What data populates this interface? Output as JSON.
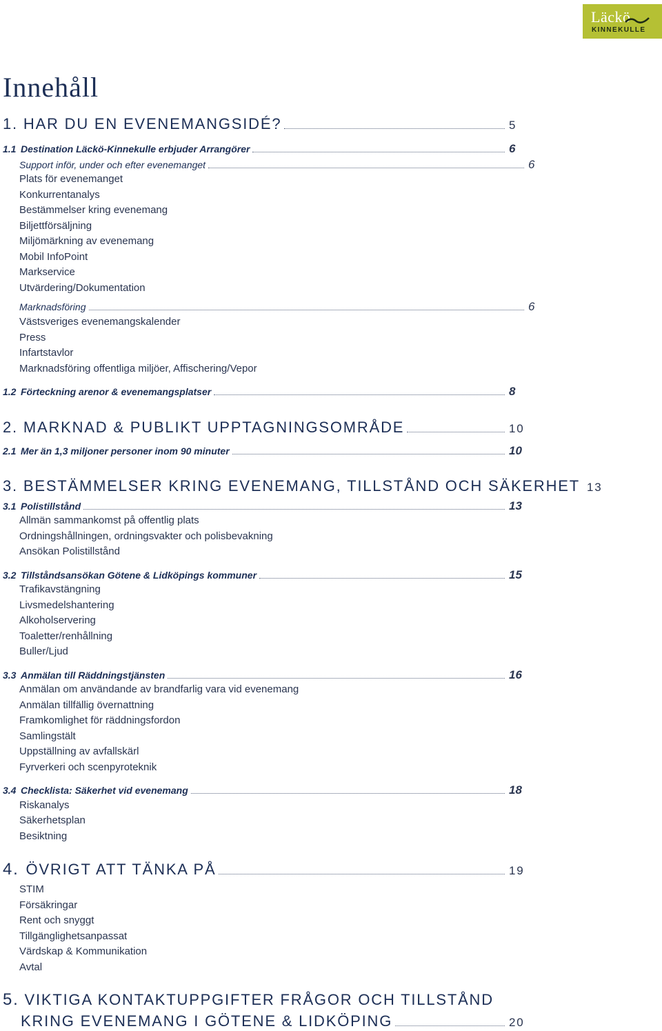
{
  "logo": {
    "line1": "Läckö",
    "line2": "KINNEKULLE",
    "bg": "#b5c034"
  },
  "title": "Innehåll",
  "toc": {
    "s1": {
      "num": "1.",
      "label": "Har du en evenemangsidé?",
      "page": "5"
    },
    "s1_1": {
      "num": "1.1",
      "label": "Destination Läckö-Kinnekulle erbjuder Arrangörer",
      "page": "6"
    },
    "support": {
      "label": "Support inför, under och efter evenemanget",
      "page": "6"
    },
    "support_items": [
      "Plats för evenemanget",
      "Konkurrentanalys",
      "Bestämmelser kring evenemang",
      "Biljettförsäljning",
      "Miljömärkning av evenemang",
      "Mobil InfoPoint",
      "Markservice",
      "Utvärdering/Dokumentation"
    ],
    "marknad": {
      "label": "Marknadsföring",
      "page": "6"
    },
    "marknad_items": [
      "Västsveriges evenemangskalender",
      "Press",
      "Infartstavlor",
      "Marknadsföring offentliga miljöer, Affischering/Vepor"
    ],
    "s1_2": {
      "num": "1.2",
      "label": "Förteckning arenor & evenemangsplatser",
      "page": "8"
    },
    "s2": {
      "num": "2.",
      "label": "Marknad & publikt upptagningsområde",
      "page": "10"
    },
    "s2_1": {
      "num": "2.1",
      "label": "Mer än 1,3 miljoner personer inom 90 minuter",
      "page": "10"
    },
    "s3": {
      "num": "3.",
      "label": "Bestämmelser kring evenemang, tillstånd och säkerhet",
      "page": "13"
    },
    "s3_1": {
      "num": "3.1",
      "label": "Polistillstånd",
      "page": "13"
    },
    "s3_1_items": [
      "Allmän sammankomst på offentlig plats",
      "Ordningshållningen, ordningsvakter och polisbevakning",
      "Ansökan Polistillstånd"
    ],
    "s3_2": {
      "num": "3.2",
      "label": "Tillståndsansökan Götene & Lidköpings kommuner",
      "page": "15"
    },
    "s3_2_items": [
      "Trafikavstängning",
      "Livsmedelshantering",
      "Alkoholservering",
      "Toaletter/renhållning",
      "Buller/Ljud"
    ],
    "s3_3": {
      "num": "3.3",
      "label": "Anmälan till Räddningstjänsten",
      "page": "16"
    },
    "s3_3_items": [
      "Anmälan om användande av brandfarlig vara vid evenemang",
      "Anmälan tillfällig övernattning",
      "Framkomlighet för räddningsfordon",
      "Samlingstält",
      "Uppställning av avfallskärl",
      "Fyrverkeri och scenpyroteknik"
    ],
    "s3_4": {
      "num": "3.4",
      "label": "Checklista: Säkerhet vid evenemang",
      "page": "18"
    },
    "s3_4_items": [
      "Riskanalys",
      "Säkerhetsplan",
      "Besiktning"
    ],
    "s4": {
      "num": "4.",
      "label": "Övrigt att tänka på",
      "page": "19"
    },
    "s4_items": [
      "STIM",
      "Försäkringar",
      "Rent och snyggt",
      "Tillgänglighetsanpassat",
      "Värdskap & Kommunikation",
      "Avtal"
    ],
    "s5": {
      "num": "5.",
      "label_line1": "Viktiga kontaktuppgifter frågor och tillstånd",
      "label_line2": "kring evenemang i Götene & Lidköping",
      "page": "20"
    }
  }
}
